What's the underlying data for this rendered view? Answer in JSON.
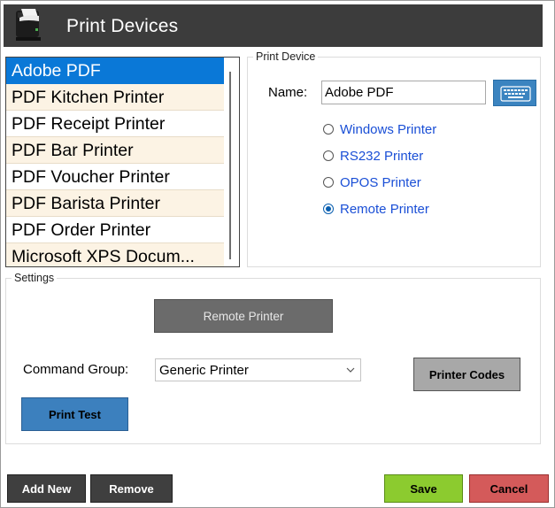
{
  "window": {
    "title": "Print Devices",
    "title_icon": "receipt-printer-icon"
  },
  "device_list": {
    "selected_index": 0,
    "items": [
      "Adobe PDF",
      "PDF Kitchen Printer",
      "PDF Receipt Printer",
      "PDF Bar Printer",
      "PDF Voucher Printer",
      "PDF Barista Printer",
      "PDF Order Printer",
      "Microsoft XPS Docum..."
    ]
  },
  "print_device": {
    "legend": "Print Device",
    "name_label": "Name:",
    "name_value": "Adobe PDF",
    "keyboard_icon": "keyboard-icon",
    "types": [
      {
        "label": "Windows Printer",
        "checked": false
      },
      {
        "label": "RS232 Printer",
        "checked": false
      },
      {
        "label": "OPOS Printer",
        "checked": false
      },
      {
        "label": "Remote Printer",
        "checked": true
      }
    ]
  },
  "settings": {
    "legend": "Settings",
    "mode_button": "Remote Printer",
    "command_group_label": "Command Group:",
    "command_group_value": "Generic Printer",
    "printer_codes_button": "Printer Codes",
    "print_test_button": "Print Test"
  },
  "footer": {
    "add_new": "Add New",
    "remove": "Remove",
    "save": "Save",
    "cancel": "Cancel"
  },
  "colors": {
    "titlebar": "#3c3c3c",
    "selection": "#0a78d7",
    "row_alt": "#fcf3e4",
    "radio_text": "#1a4fd6",
    "save": "#8ccb2f",
    "cancel": "#d45a5a",
    "accent_blue": "#3c80be"
  }
}
